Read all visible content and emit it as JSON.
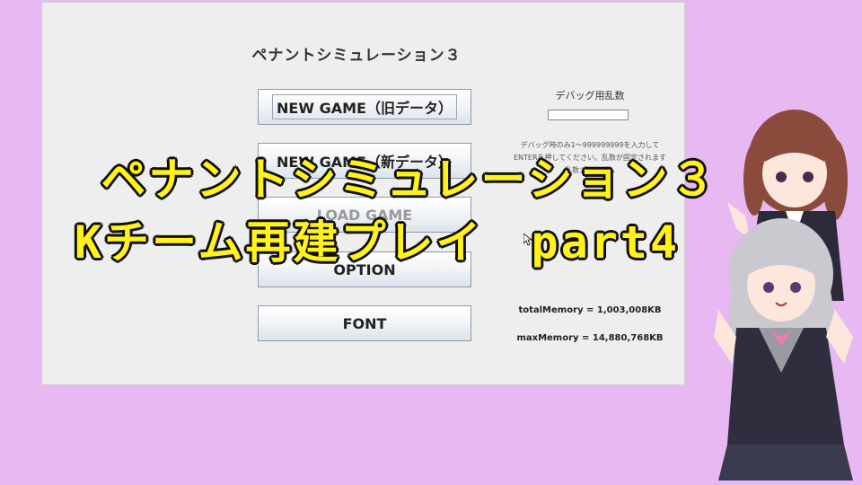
{
  "window": {
    "title": "ペナントシミュレーション３",
    "menu": [
      {
        "label": "NEW GAME（旧データ）",
        "state": "focused"
      },
      {
        "label": "NEW GAME（新データ）",
        "state": "normal"
      },
      {
        "label": "LOAD GAME",
        "state": "disabled"
      },
      {
        "label": "OPTION",
        "state": "normal"
      },
      {
        "label": "FONT",
        "state": "normal"
      }
    ],
    "debug": {
      "title": "デバッグ用乱数",
      "input_value": "",
      "note_line1": "デバッグ時のみ1～999999999を入力して",
      "note_line2": "ENTERを押してください。乱数が固定されます",
      "note_line3": "乱数：ランダム"
    },
    "memory": {
      "total": "totalMemory = 1,003,008KB",
      "max": "maxMemory = 14,880,768KB"
    }
  },
  "overlay": {
    "line1": "ペナントシミュレーション３",
    "line2": "Kチーム再建プレイ　part4"
  },
  "colors": {
    "background": "#e8b8f2",
    "caption_fill": "#fff21a",
    "caption_stroke": "#111111"
  }
}
